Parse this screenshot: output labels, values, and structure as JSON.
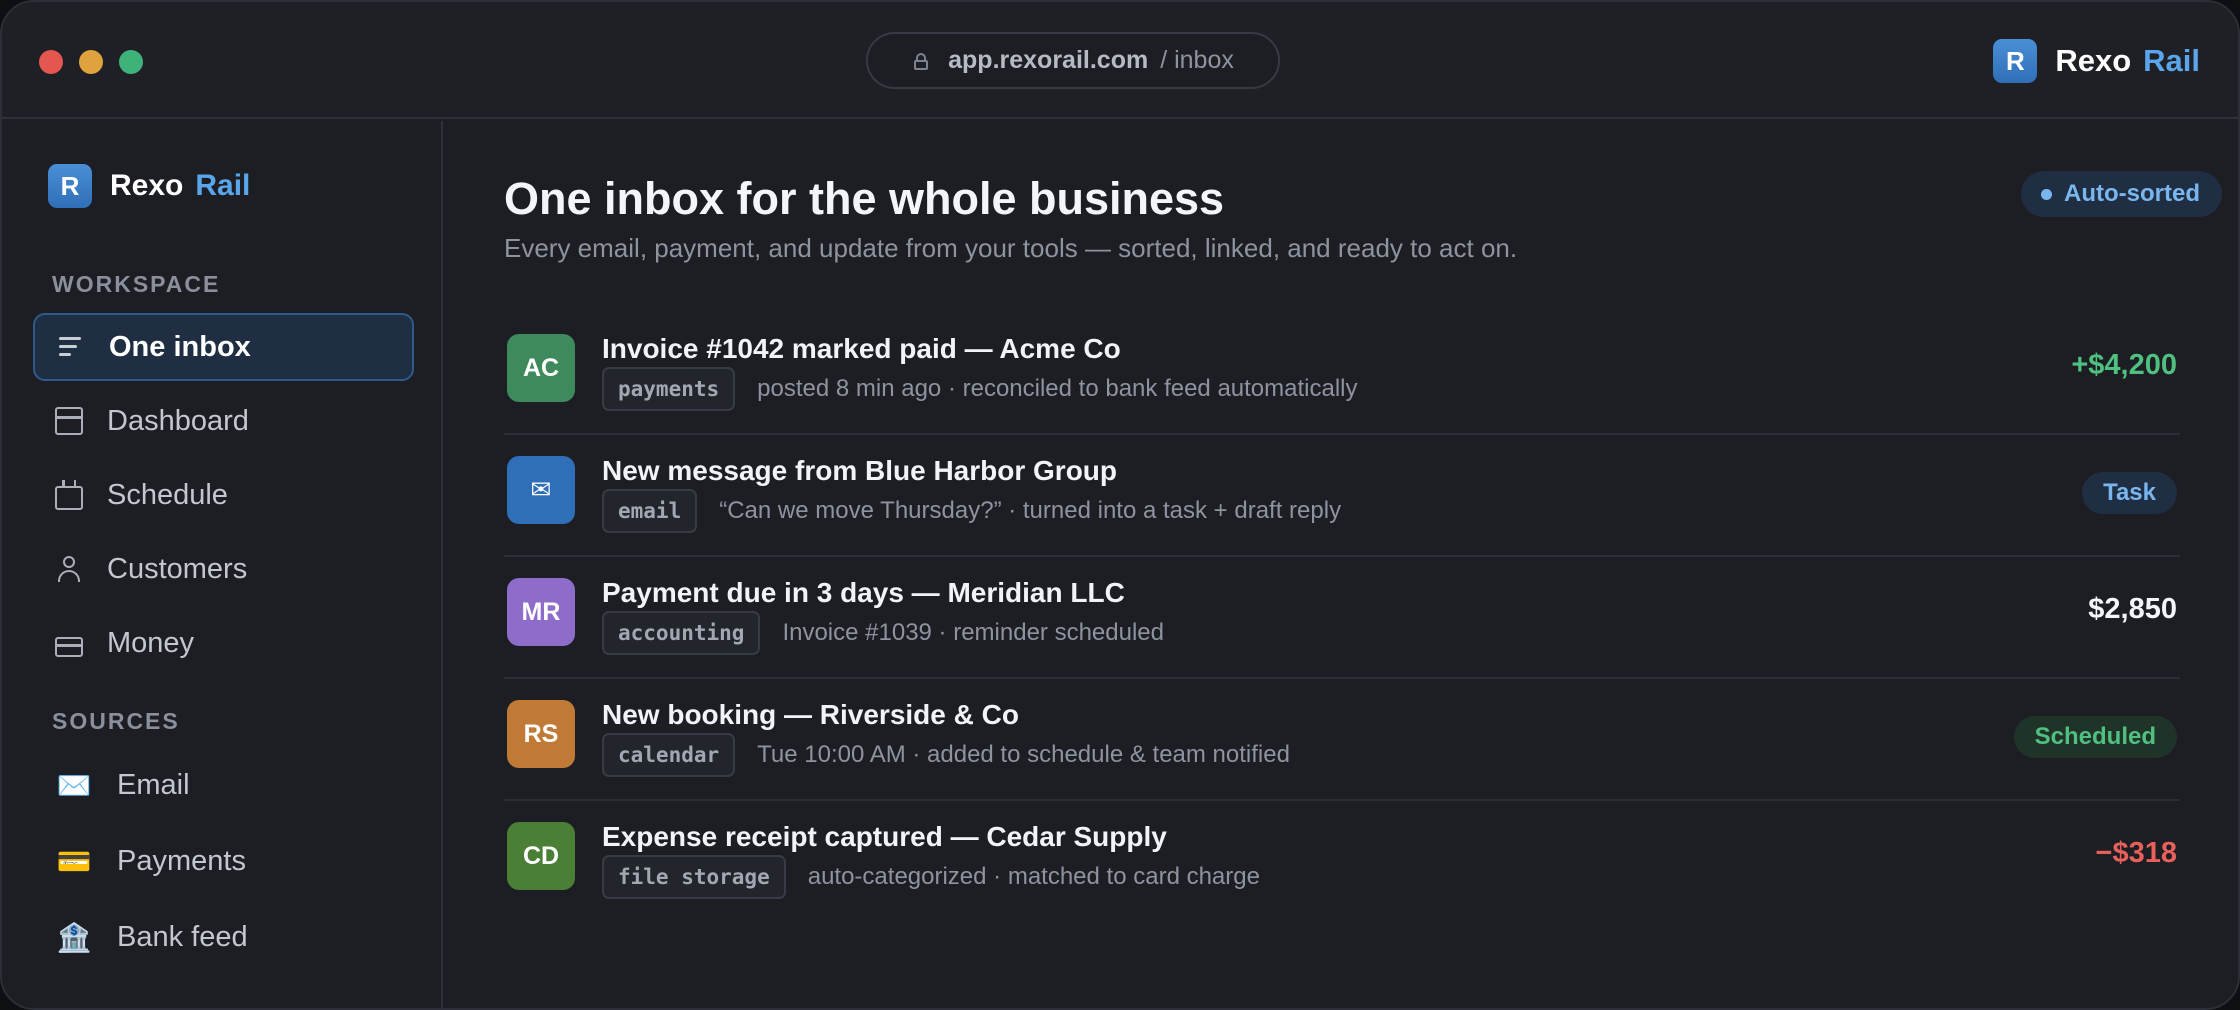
{
  "titlebar": {
    "url_host": "app.rexorail.com",
    "url_path": "/ inbox",
    "brand_letter": "R",
    "brand_name": "Rexo",
    "brand_accent": "Rail"
  },
  "sidebar": {
    "brand_letter": "R",
    "brand_name": "Rexo",
    "brand_accent": "Rail",
    "workspace_label": "WORKSPACE",
    "workspace_items": [
      {
        "label": "One inbox",
        "icon": "inbox-lines-icon",
        "active": true
      },
      {
        "label": "Dashboard",
        "icon": "dashboard-icon"
      },
      {
        "label": "Schedule",
        "icon": "calendar-icon"
      },
      {
        "label": "Customers",
        "icon": "user-icon"
      },
      {
        "label": "Money",
        "icon": "card-icon"
      }
    ],
    "sources_label": "SOURCES",
    "source_items": [
      {
        "label": "Email",
        "icon": "envelope-icon",
        "glyph": "✉️"
      },
      {
        "label": "Payments",
        "icon": "credit-card-icon",
        "glyph": "💳"
      },
      {
        "label": "Bank feed",
        "icon": "bank-icon",
        "glyph": "🏦"
      }
    ]
  },
  "main": {
    "title": "One inbox for the whole business",
    "subtitle": "Every email, payment, and update from your tools — sorted, linked, and ready to act on.",
    "badge": "Auto-sorted",
    "rows": [
      {
        "avatar": "AC",
        "avatar_color": "#3f8a5c",
        "title": "Invoice #1042 marked paid — Acme Co",
        "tag": "payments",
        "meta": "posted 8 min ago · reconciled to bank feed automatically",
        "amount": "+$4,200",
        "amount_color": "#4fc07f"
      },
      {
        "avatar": "✉",
        "avatar_color": "#2f6fb8",
        "title": "New message from Blue Harbor Group",
        "tag": "email",
        "meta": "“Can we move Thursday?” · turned into a task + draft reply",
        "pill": "Task",
        "pill_bg": "#1f2e42",
        "pill_color": "#7ab6ee"
      },
      {
        "avatar": "MR",
        "avatar_color": "#8e6cc9",
        "title": "Payment due in 3 days — Meridian LLC",
        "tag": "accounting",
        "meta": "Invoice #1039 · reminder scheduled",
        "amount": "$2,850",
        "amount_color": "#f4f5f8"
      },
      {
        "avatar": "RS",
        "avatar_color": "#c07a36",
        "title": "New booking — Riverside & Co",
        "tag": "calendar",
        "meta": "Tue 10:00 AM · added to schedule & team notified",
        "pill": "Scheduled",
        "pill_bg": "#1f3328",
        "pill_color": "#4fc07f"
      },
      {
        "avatar": "CD",
        "avatar_color": "#4a7f35",
        "title": "Expense receipt captured — Cedar Supply",
        "tag": "file storage",
        "meta": "auto-categorized · matched to card charge",
        "amount": "−$318",
        "amount_color": "#e8605a"
      }
    ]
  }
}
